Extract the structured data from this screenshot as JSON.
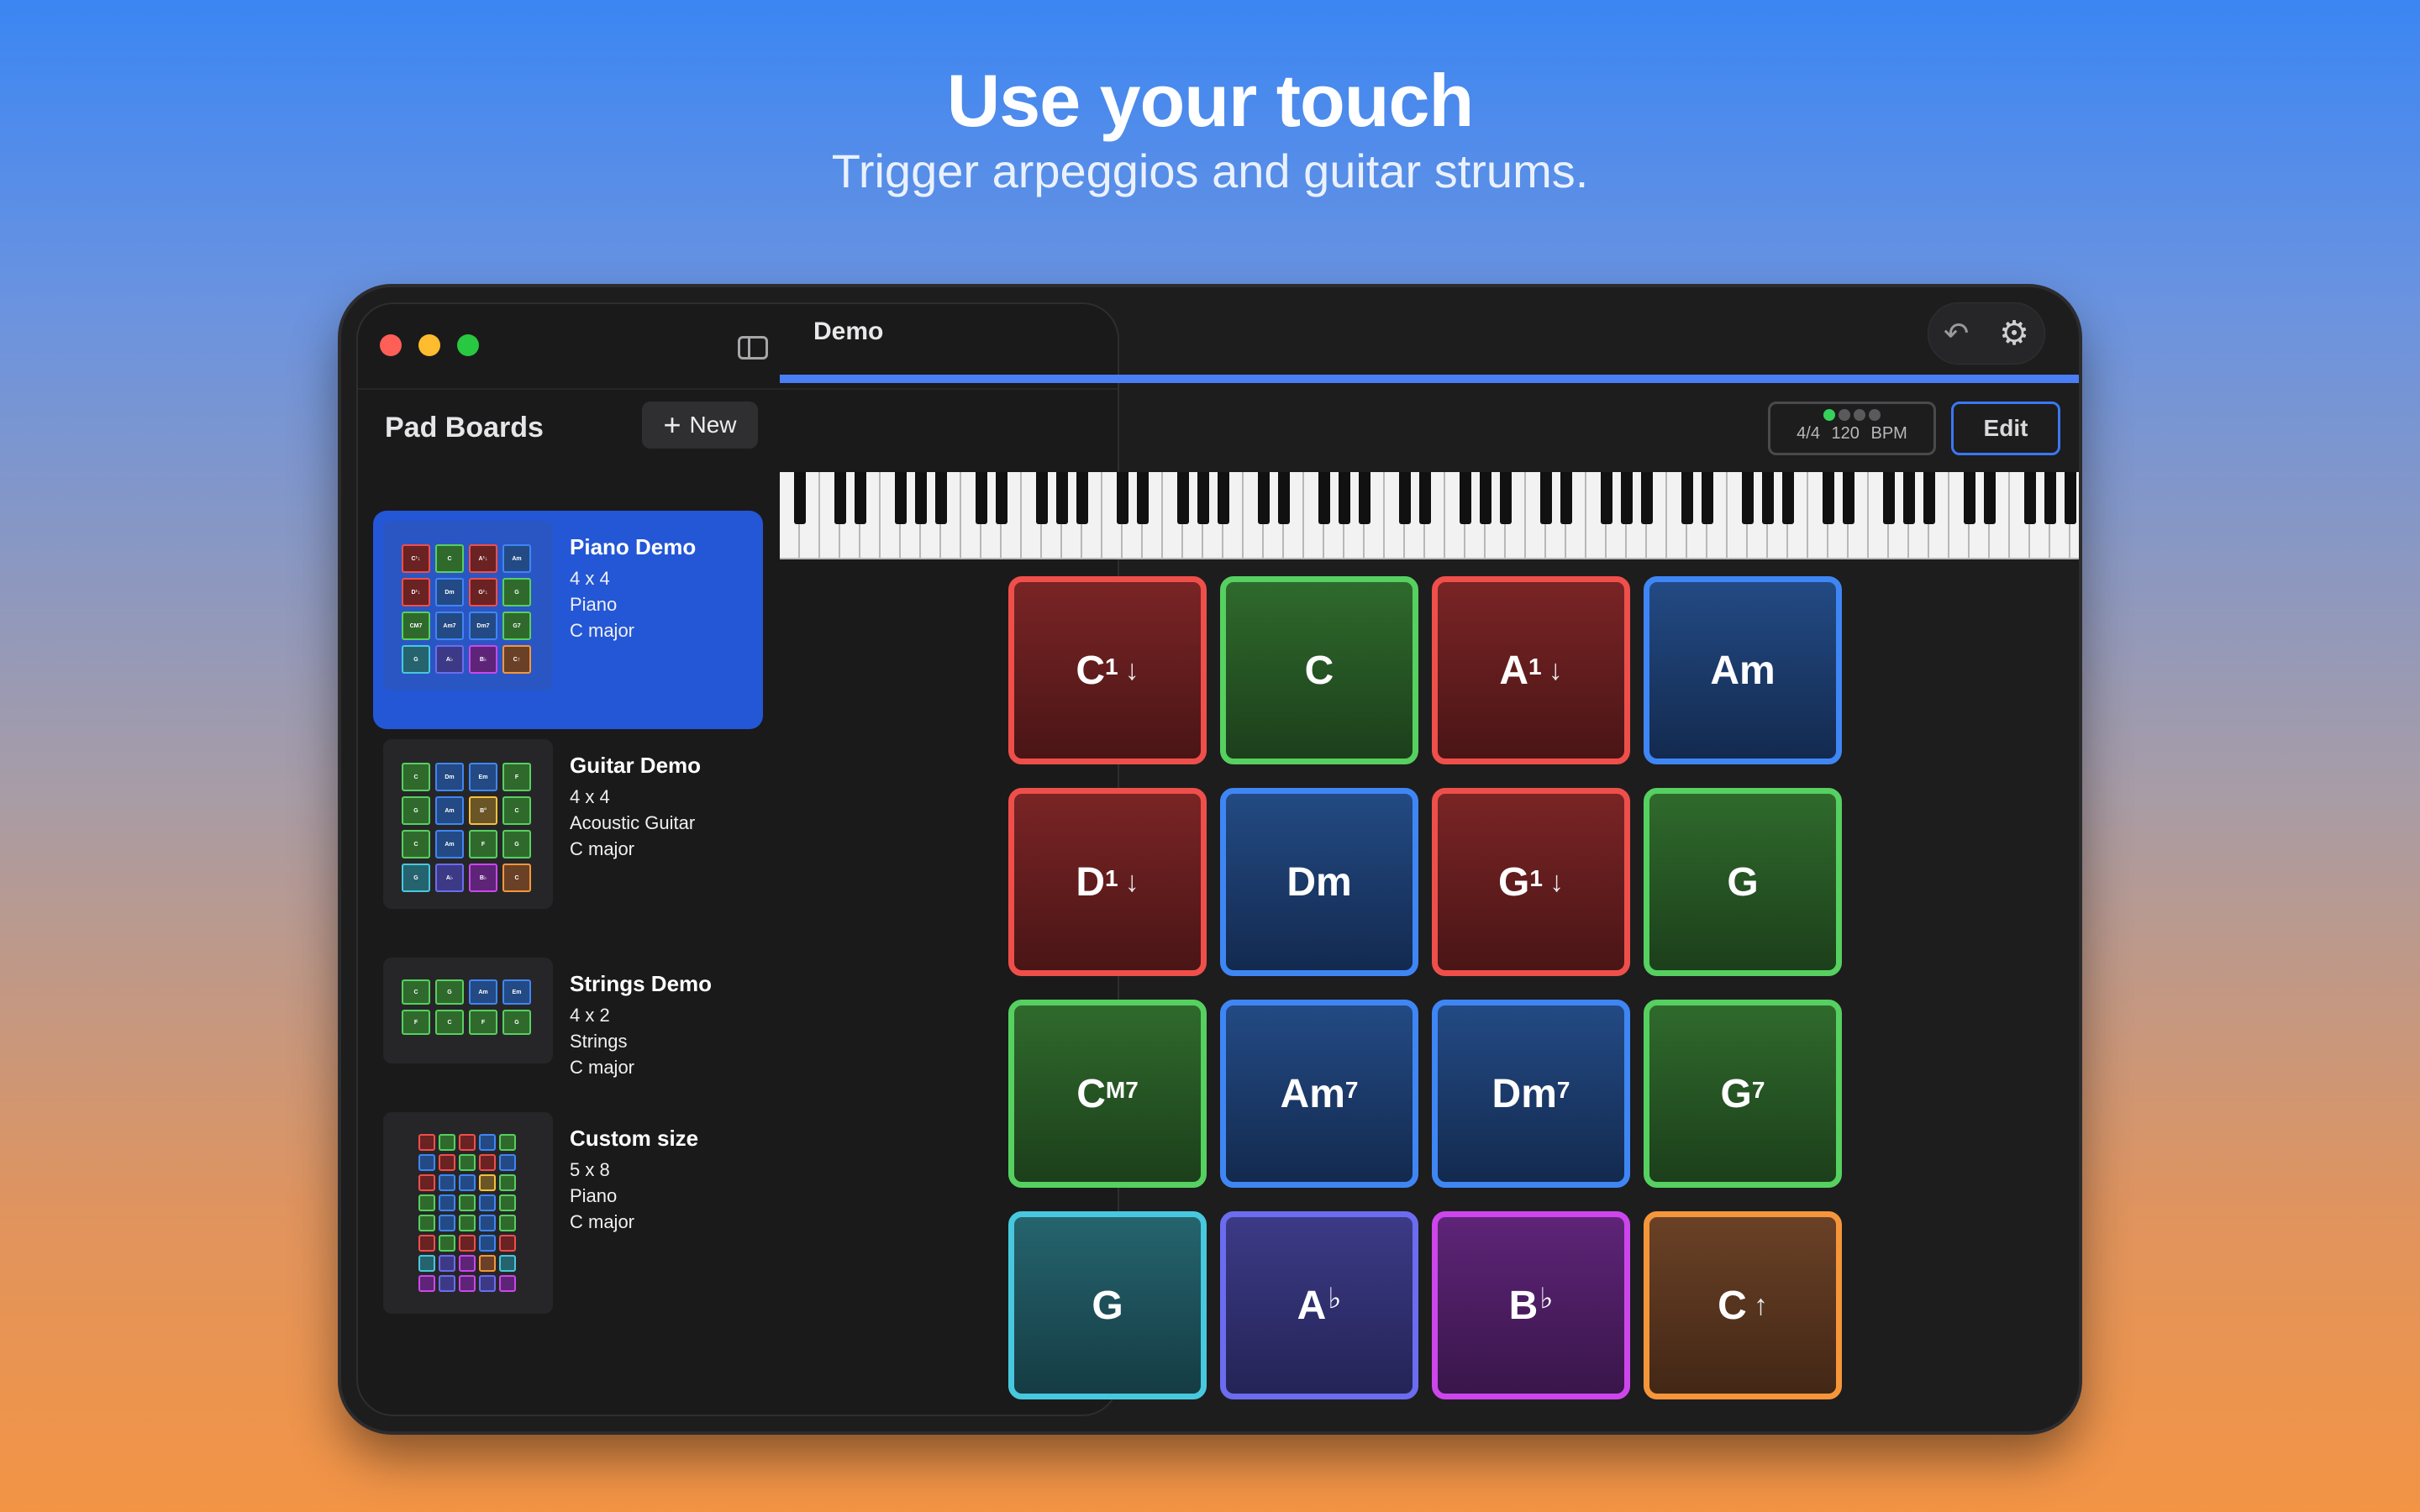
{
  "headline": {
    "title": "Use your touch",
    "subtitle": "Trigger arpeggios and guitar strums."
  },
  "colors": {
    "accent": "#3a78f2",
    "red": "#ef4f4a",
    "green": "#56d060",
    "blue": "#3f86f5",
    "teal": "#48c8de",
    "indigo": "#6b6cf0",
    "purple": "#cc46ec",
    "orange": "#f6963b"
  },
  "sidebar": {
    "title": "Pad Boards",
    "new_label": "New",
    "boards": [
      {
        "name": "Piano Demo",
        "size": "4 x 4",
        "instrument": "Piano",
        "key": "C major",
        "selected": true
      },
      {
        "name": "Guitar Demo",
        "size": "4 x 4",
        "instrument": "Acoustic Guitar",
        "key": "C major",
        "selected": false
      },
      {
        "name": "Strings Demo",
        "size": "4 x 2",
        "instrument": "Strings",
        "key": "C major",
        "selected": false
      },
      {
        "name": "Custom size",
        "size": "5 x 8",
        "instrument": "Piano",
        "key": "C major",
        "selected": false
      }
    ]
  },
  "main": {
    "title": "Demo",
    "time_signature": "4/4",
    "tempo": "120 BPM",
    "edit_label": "Edit",
    "icons": [
      "undo-icon",
      "gear-icon"
    ]
  },
  "pads": [
    {
      "root": "C",
      "sup": "1",
      "arrow": "↓",
      "color": "red"
    },
    {
      "root": "C",
      "sup": "",
      "arrow": "",
      "color": "green"
    },
    {
      "root": "A",
      "sup": "1",
      "arrow": "↓",
      "color": "red"
    },
    {
      "root": "Am",
      "sup": "",
      "arrow": "",
      "color": "blue"
    },
    {
      "root": "D",
      "sup": "1",
      "arrow": "↓",
      "color": "red"
    },
    {
      "root": "Dm",
      "sup": "",
      "arrow": "",
      "color": "blue"
    },
    {
      "root": "G",
      "sup": "1",
      "arrow": "↓",
      "color": "red"
    },
    {
      "root": "G",
      "sup": "",
      "arrow": "",
      "color": "green"
    },
    {
      "root": "C",
      "sup": "M7",
      "arrow": "",
      "color": "green"
    },
    {
      "root": "Am",
      "sup": "7",
      "arrow": "",
      "color": "blue"
    },
    {
      "root": "Dm",
      "sup": "7",
      "arrow": "",
      "color": "blue"
    },
    {
      "root": "G",
      "sup": "7",
      "arrow": "",
      "color": "green"
    },
    {
      "root": "G",
      "sup": "",
      "arrow": "",
      "color": "teal"
    },
    {
      "root": "A",
      "acc": "♭",
      "sup": "",
      "arrow": "",
      "color": "indigo"
    },
    {
      "root": "B",
      "acc": "♭",
      "sup": "",
      "arrow": "",
      "color": "purple"
    },
    {
      "root": "C",
      "sup": "",
      "arrow": "↑",
      "color": "orange"
    }
  ]
}
